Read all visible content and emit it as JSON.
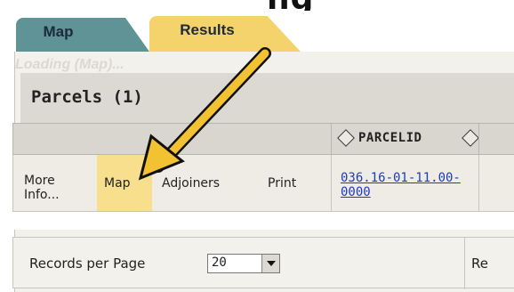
{
  "heading_fragment": "ng",
  "tabs": [
    {
      "label": "Map",
      "active": false
    },
    {
      "label": "Results",
      "active": true
    }
  ],
  "loading_text": "Loading (Map)...",
  "page_title": "Parcels (1)",
  "table": {
    "columns": [
      "PARCELID"
    ],
    "rows": [
      {
        "more_info": "More Info...",
        "map": "Map",
        "adjoiners": "Adjoiners",
        "print": "Print",
        "parcel_id": "036.16-01-11.00-0000"
      }
    ]
  },
  "records": {
    "label": "Records per Page",
    "value": "20",
    "next_truncated": "Re"
  },
  "colors": {
    "tab_map": "#5f9395",
    "tab_results": "#f4d36c",
    "highlight_cell": "#f8df8d",
    "link": "#1a3db8",
    "arrow": "#f2c232"
  },
  "annotation": {
    "icon": "arrow-pointer-icon"
  }
}
